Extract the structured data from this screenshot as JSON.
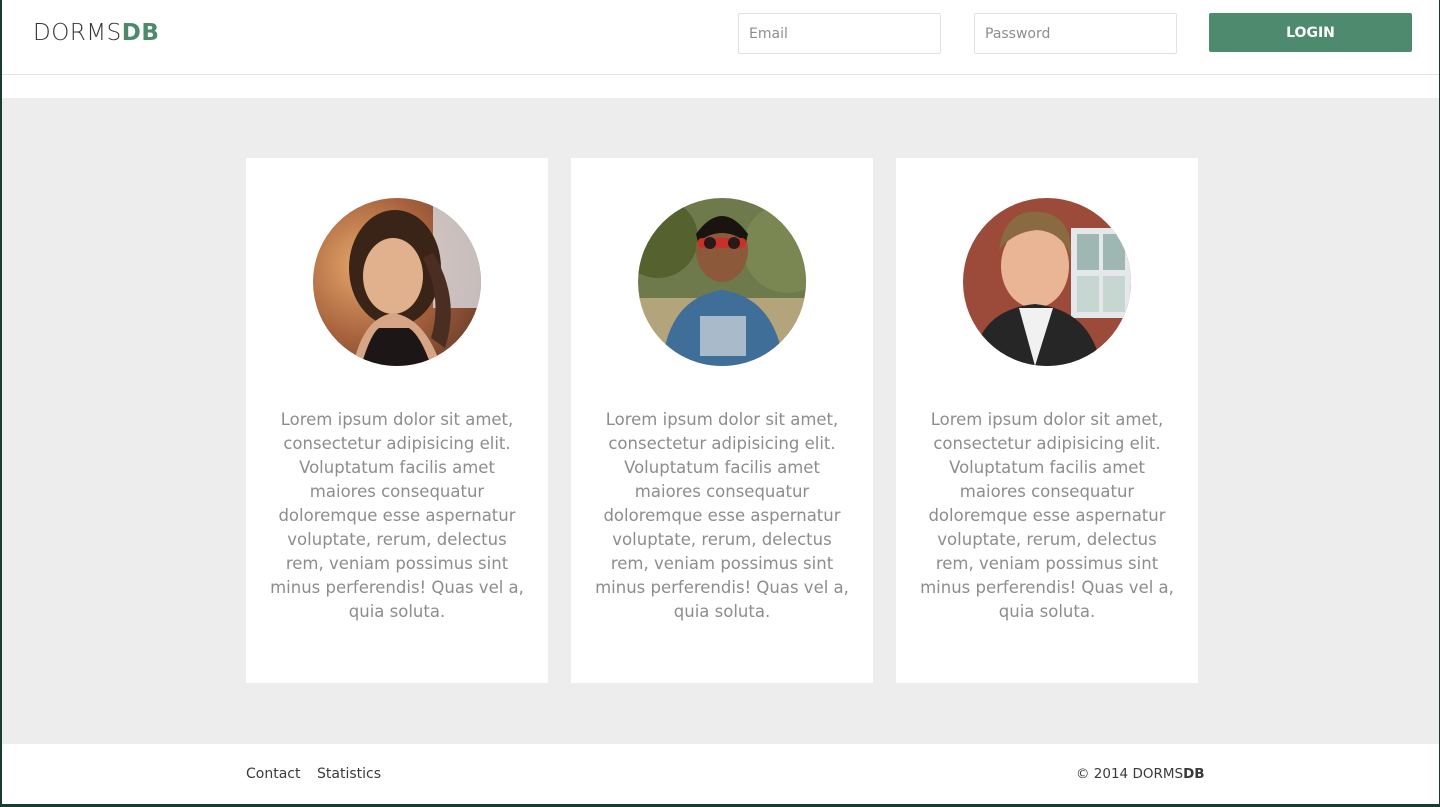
{
  "header": {
    "logo_light": "DORMS",
    "logo_bold": "DB",
    "email_placeholder": "Email",
    "password_placeholder": "Password",
    "login_label": "LOGIN"
  },
  "cards": [
    {
      "avatar_icon": "profile-photo-woman",
      "text": "Lorem ipsum dolor sit amet, consectetur adipisicing elit. Voluptatum facilis amet maiores consequatur doloremque esse aspernatur voluptate, rerum, delectus rem, veniam possimus sint minus perferendis! Quas vel a, quia soluta."
    },
    {
      "avatar_icon": "profile-photo-man-sunglasses",
      "text": "Lorem ipsum dolor sit amet, consectetur adipisicing elit. Voluptatum facilis amet maiores consequatur doloremque esse aspernatur voluptate, rerum, delectus rem, veniam possimus sint minus perferendis! Quas vel a, quia soluta."
    },
    {
      "avatar_icon": "profile-photo-man-smiling",
      "text": "Lorem ipsum dolor sit amet, consectetur adipisicing elit. Voluptatum facilis amet maiores consequatur doloremque esse aspernatur voluptate, rerum, delectus rem, veniam possimus sint minus perferendis! Quas vel a, quia soluta."
    }
  ],
  "footer": {
    "links": [
      "Contact",
      "Statistics"
    ],
    "copyright_prefix": "© 2014 DORMS",
    "copyright_bold": "DB"
  },
  "colors": {
    "accent": "#4e8a6e",
    "page_background": "#ededed",
    "card_text": "#8d8d8d"
  }
}
